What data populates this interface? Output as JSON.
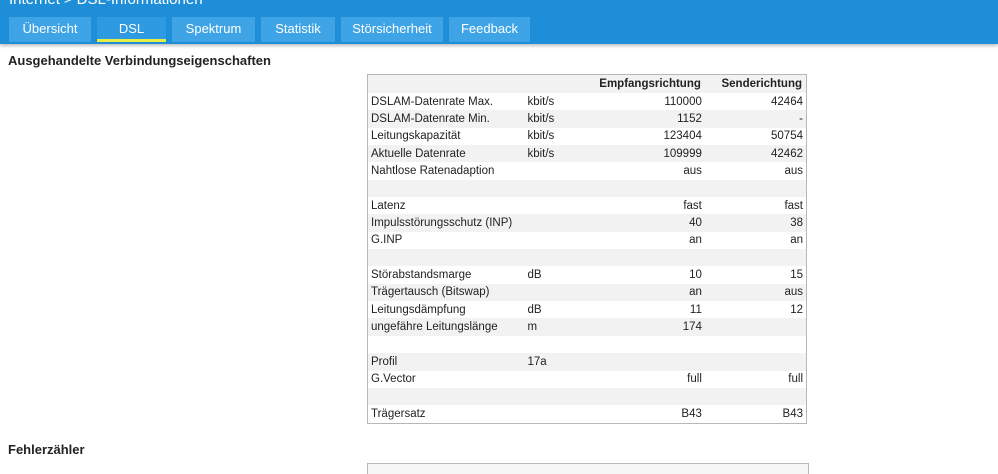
{
  "breadcrumb": {
    "section": "Internet",
    "separator": ">",
    "page": "DSL-Informationen"
  },
  "tabs": [
    {
      "label": "Übersicht",
      "active": false
    },
    {
      "label": "DSL",
      "active": true
    },
    {
      "label": "Spektrum",
      "active": false
    },
    {
      "label": "Statistik",
      "active": false
    },
    {
      "label": "Störsicherheit",
      "active": false
    },
    {
      "label": "Feedback",
      "active": false
    }
  ],
  "section1": {
    "title": "Ausgehandelte Verbindungseigenschaften"
  },
  "table": {
    "headers": [
      "",
      "",
      "Empfangsrichtung",
      "Senderichtung"
    ],
    "rows": [
      [
        "DSLAM-Datenrate Max.",
        "kbit/s",
        "110000",
        "42464"
      ],
      [
        "DSLAM-Datenrate Min.",
        "kbit/s",
        "1152",
        "-"
      ],
      [
        "Leitungskapazität",
        "kbit/s",
        "123404",
        "50754"
      ],
      [
        "Aktuelle Datenrate",
        "kbit/s",
        "109999",
        "42462"
      ],
      [
        "Nahtlose Ratenadaption",
        "",
        "aus",
        "aus"
      ],
      [
        "",
        "",
        "",
        ""
      ],
      [
        "Latenz",
        "",
        "fast",
        "fast"
      ],
      [
        "Impulsstörungsschutz (INP)",
        "",
        "40",
        "38"
      ],
      [
        "G.INP",
        "",
        "an",
        "an"
      ],
      [
        "",
        "",
        "",
        ""
      ],
      [
        "Störabstandsmarge",
        "dB",
        "10",
        "15"
      ],
      [
        "Trägertausch (Bitswap)",
        "",
        "an",
        "aus"
      ],
      [
        "Leitungsdämpfung",
        "dB",
        "11",
        "12"
      ],
      [
        "ungefähre Leitungslänge",
        "m",
        "174",
        ""
      ],
      [
        "",
        "",
        "",
        ""
      ],
      [
        "Profil",
        "17a",
        "",
        ""
      ],
      [
        "G.Vector",
        "",
        "full",
        "full"
      ],
      [
        "",
        "",
        "",
        ""
      ],
      [
        "Trägersatz",
        "",
        "B43",
        "B43"
      ]
    ]
  },
  "section2": {
    "title": "Fehlerzähler"
  },
  "colors": {
    "header_bar": "#1f8ed8",
    "tab": "#3ea4e6",
    "active_tab_underline": "#e6ee46"
  }
}
